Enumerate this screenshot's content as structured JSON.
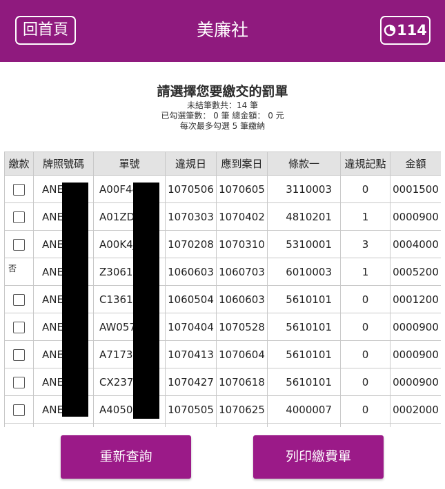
{
  "header": {
    "home_label": "回首頁",
    "title": "美廉社",
    "timer_value": "114",
    "timer_icon": "timer-icon"
  },
  "summary": {
    "heading": "請選擇您要繳交的罰單",
    "unpaid_count_text": "未結筆數共：14 筆",
    "selected_text": "已勾選筆數： 0 筆 總金額： 0 元",
    "limit_text": "每次最多勾選 5 筆繳納"
  },
  "table": {
    "headers": [
      "繳款",
      "牌照號碼",
      "單號",
      "違規日",
      "應到案日",
      "條款一",
      "違規記點",
      "金額"
    ],
    "rows": [
      {
        "pay": "checkbox",
        "plate": "ANE-",
        "ticket": "A00F44",
        "date": "1070506",
        "due": "1070605",
        "clause": "3110003",
        "points": "0",
        "amount": "0001500"
      },
      {
        "pay": "checkbox",
        "plate": "ANE-",
        "ticket": "A01ZDH",
        "date": "1070303",
        "due": "1070402",
        "clause": "4810201",
        "points": "1",
        "amount": "0000900"
      },
      {
        "pay": "checkbox",
        "plate": "ANE-",
        "ticket": "A00K4J",
        "date": "1070208",
        "due": "1070310",
        "clause": "5310001",
        "points": "3",
        "amount": "0004000"
      },
      {
        "pay": "否",
        "plate": "ANE-",
        "ticket": "Z30614",
        "date": "1060603",
        "due": "1060703",
        "clause": "6010003",
        "points": "1",
        "amount": "0005200"
      },
      {
        "pay": "checkbox",
        "plate": "ANE-",
        "ticket": "C13613",
        "date": "1060504",
        "due": "1060603",
        "clause": "5610101",
        "points": "0",
        "amount": "0001200"
      },
      {
        "pay": "checkbox",
        "plate": "ANE-",
        "ticket": "AW0573",
        "date": "1070404",
        "due": "1070528",
        "clause": "5610101",
        "points": "0",
        "amount": "0000900"
      },
      {
        "pay": "checkbox",
        "plate": "ANE-",
        "ticket": "A71738",
        "date": "1070413",
        "due": "1070604",
        "clause": "5610101",
        "points": "0",
        "amount": "0000900"
      },
      {
        "pay": "checkbox",
        "plate": "ANE-",
        "ticket": "CX2372",
        "date": "1070427",
        "due": "1070618",
        "clause": "5610101",
        "points": "0",
        "amount": "0000900"
      },
      {
        "pay": "checkbox",
        "plate": "ANE-",
        "ticket": "A40507",
        "date": "1070505",
        "due": "1070625",
        "clause": "4000007",
        "points": "0",
        "amount": "0002000"
      }
    ]
  },
  "actions": {
    "requery_label": "重新查詢",
    "print_label": "列印繳費單"
  },
  "colors": {
    "brand": "#8f1a7e",
    "button": "#9b1a88",
    "header_bg": "#e3e3e3"
  }
}
